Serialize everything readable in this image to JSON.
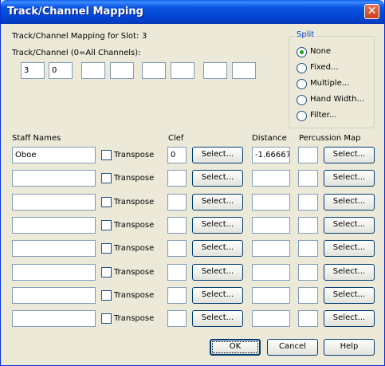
{
  "window": {
    "title": "Track/Channel Mapping",
    "close_symbol": "✕"
  },
  "slot": {
    "label": "Track/Channel Mapping for Slot:",
    "value": "3"
  },
  "track_channel": {
    "label": "Track/Channel (0=All Channels):",
    "fields": [
      "3",
      "0",
      "",
      "",
      "",
      "",
      "",
      ""
    ]
  },
  "split": {
    "legend": "Split",
    "options": [
      {
        "label": "None",
        "selected": true
      },
      {
        "label": "Fixed...",
        "selected": false
      },
      {
        "label": "Multiple...",
        "selected": false
      },
      {
        "label": "Hand Width...",
        "selected": false
      },
      {
        "label": "Filter...",
        "selected": false
      }
    ]
  },
  "headers": {
    "staff_names": "Staff Names",
    "clef": "Clef",
    "distance": "Distance",
    "percussion_map": "Percussion Map"
  },
  "rows": [
    {
      "staff": "Oboe",
      "transpose_label": "Transpose",
      "clef": "0",
      "clef_button": "Select...",
      "distance": "-1.66667",
      "perc": "",
      "perc_button": "Select..."
    },
    {
      "staff": "",
      "transpose_label": "Transpose",
      "clef": "",
      "clef_button": "Select...",
      "distance": "",
      "perc": "",
      "perc_button": "Select..."
    },
    {
      "staff": "",
      "transpose_label": "Transpose",
      "clef": "",
      "clef_button": "Select...",
      "distance": "",
      "perc": "",
      "perc_button": "Select..."
    },
    {
      "staff": "",
      "transpose_label": "Transpose",
      "clef": "",
      "clef_button": "Select...",
      "distance": "",
      "perc": "",
      "perc_button": "Select..."
    },
    {
      "staff": "",
      "transpose_label": "Transpose",
      "clef": "",
      "clef_button": "Select...",
      "distance": "",
      "perc": "",
      "perc_button": "Select..."
    },
    {
      "staff": "",
      "transpose_label": "Transpose",
      "clef": "",
      "clef_button": "Select...",
      "distance": "",
      "perc": "",
      "perc_button": "Select..."
    },
    {
      "staff": "",
      "transpose_label": "Transpose",
      "clef": "",
      "clef_button": "Select...",
      "distance": "",
      "perc": "",
      "perc_button": "Select..."
    },
    {
      "staff": "",
      "transpose_label": "Transpose",
      "clef": "",
      "clef_button": "Select...",
      "distance": "",
      "perc": "",
      "perc_button": "Select..."
    }
  ],
  "footer": {
    "ok": "OK",
    "cancel": "Cancel",
    "help": "Help"
  }
}
